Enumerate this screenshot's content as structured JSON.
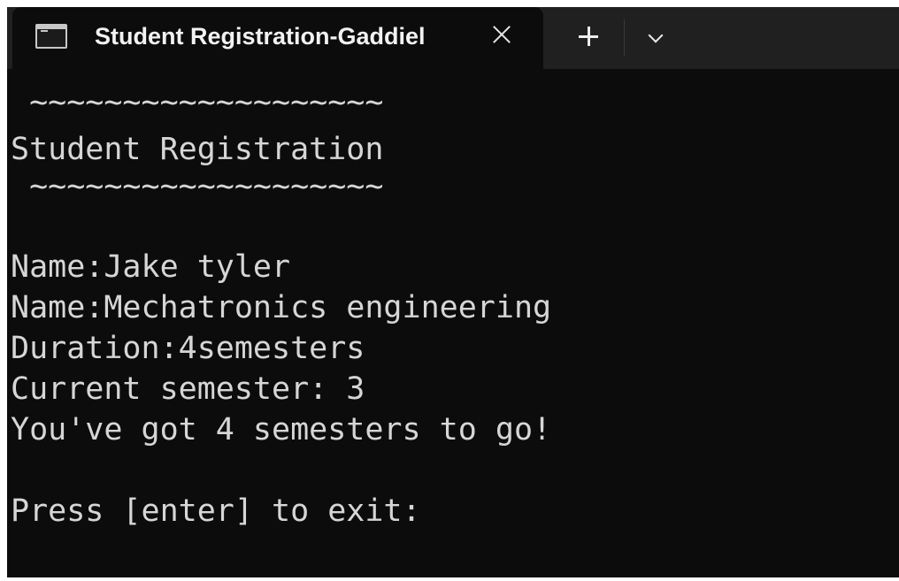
{
  "tab": {
    "title": "Student Registration-Gaddiel",
    "icon": "terminal-icon",
    "close_icon": "close-icon"
  },
  "toolbar": {
    "new_tab_icon": "plus-icon",
    "dropdown_icon": "chevron-down-icon"
  },
  "console": {
    "lines": [
      " ~~~~~~~~~~~~~~~~~~~",
      "Student Registration",
      " ~~~~~~~~~~~~~~~~~~~",
      "",
      "Name:Jake tyler",
      "Name:Mechatronics engineering",
      "Duration:4semesters",
      "Current semester: 3",
      "You've got 4 semesters to go!",
      "",
      "Press [enter] to exit:"
    ]
  },
  "colors": {
    "titlebar_bg": "#202020",
    "console_bg": "#0c0c0c",
    "text": "#d6d6d6"
  }
}
